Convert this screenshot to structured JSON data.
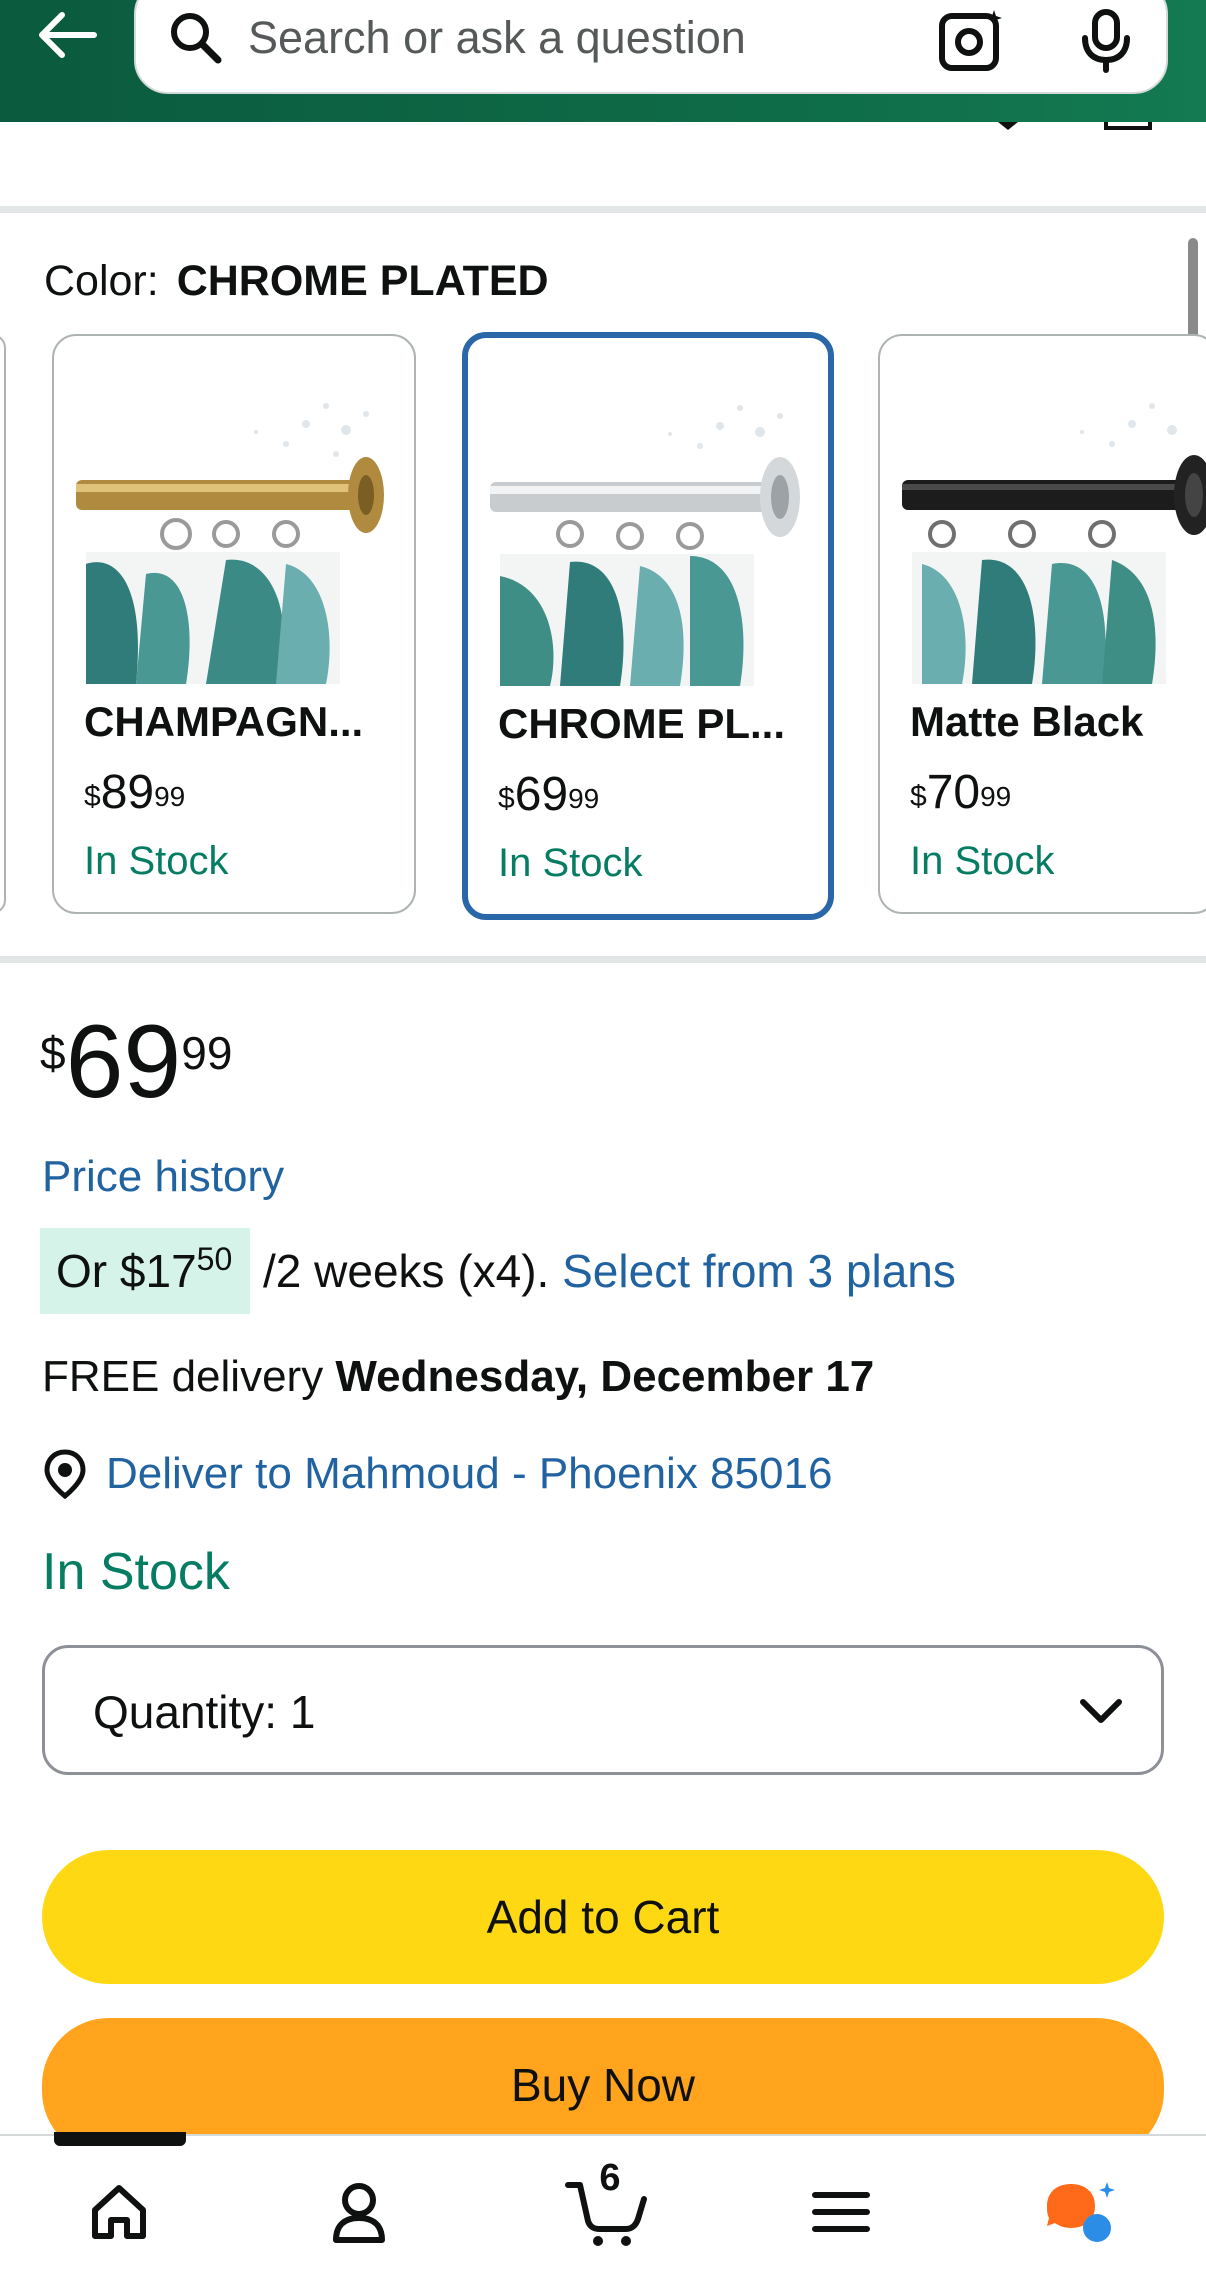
{
  "search": {
    "placeholder": "Search or ask a question"
  },
  "colors": {
    "brand_header": "#0e6a47",
    "link": "#2162a1",
    "in_stock": "#067d62",
    "add_to_cart": "#ffd814",
    "buy_now": "#ffa41c",
    "selected_border": "#2a67a8",
    "installment_bg": "#d6f3e9"
  },
  "icons": {
    "back": "back-arrow-icon",
    "search": "search-icon",
    "camera": "camera-lens-icon",
    "mic": "microphone-icon",
    "pin": "location-pin-icon",
    "chevron": "chevron-down-icon",
    "home": "home-icon",
    "account": "account-icon",
    "cart": "cart-icon",
    "menu": "menu-icon",
    "assistant": "assistant-icon"
  },
  "color_selector": {
    "label": "Color:",
    "value": "CHROME PLATED",
    "options": [
      {
        "name": "CHAMPAGN...",
        "currency": "$",
        "price_whole": "89",
        "price_frac": "99",
        "stock": "In Stock",
        "selected": false,
        "finish": "gold"
      },
      {
        "name": "CHROME PL...",
        "currency": "$",
        "price_whole": "69",
        "price_frac": "99",
        "stock": "In Stock",
        "selected": true,
        "finish": "chrome"
      },
      {
        "name": "Matte Black",
        "currency": "$",
        "price_whole": "70",
        "price_frac": "99",
        "stock": "In Stock",
        "selected": false,
        "finish": "black"
      }
    ]
  },
  "price": {
    "currency": "$",
    "whole": "69",
    "frac": "99"
  },
  "price_history": "Price history",
  "installment": {
    "prefix": "Or ",
    "currency": "$",
    "whole": "17",
    "frac": "50",
    "suffix": " /2 weeks (x4). ",
    "link": "Select from 3 plans"
  },
  "delivery": {
    "prefix": "FREE delivery ",
    "date": "Wednesday, December 17"
  },
  "deliver_to": "Deliver to Mahmoud - Phoenix 85016",
  "stock_status": "In Stock",
  "quantity": {
    "label": "Quantity: 1"
  },
  "buttons": {
    "add_to_cart": "Add to Cart",
    "buy_now": "Buy Now"
  },
  "bottom_nav": {
    "cart_count": "6"
  }
}
